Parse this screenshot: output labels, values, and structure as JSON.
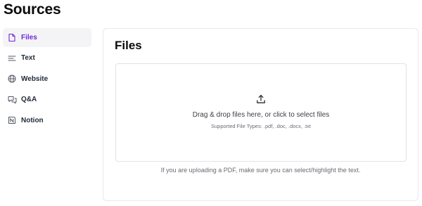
{
  "page": {
    "title": "Sources"
  },
  "sidebar": {
    "items": [
      {
        "label": "Files",
        "icon": "file-icon",
        "active": true
      },
      {
        "label": "Text",
        "icon": "text-lines-icon",
        "active": false
      },
      {
        "label": "Website",
        "icon": "globe-icon",
        "active": false
      },
      {
        "label": "Q&A",
        "icon": "chat-bubbles-icon",
        "active": false
      },
      {
        "label": "Notion",
        "icon": "notion-icon",
        "active": false
      }
    ]
  },
  "main": {
    "title": "Files",
    "dropzone": {
      "icon": "upload-icon",
      "primary_text": "Drag & drop files here, or click to select files",
      "secondary_text": "Supported File Types: .pdf, .doc, .docx, .txt"
    },
    "note": "If you are uploading a PDF, make sure you can select/highlight the text."
  },
  "colors": {
    "accent": "#6d28d9",
    "active_bg": "#f4f4f6",
    "border": "#e8e8ec"
  }
}
